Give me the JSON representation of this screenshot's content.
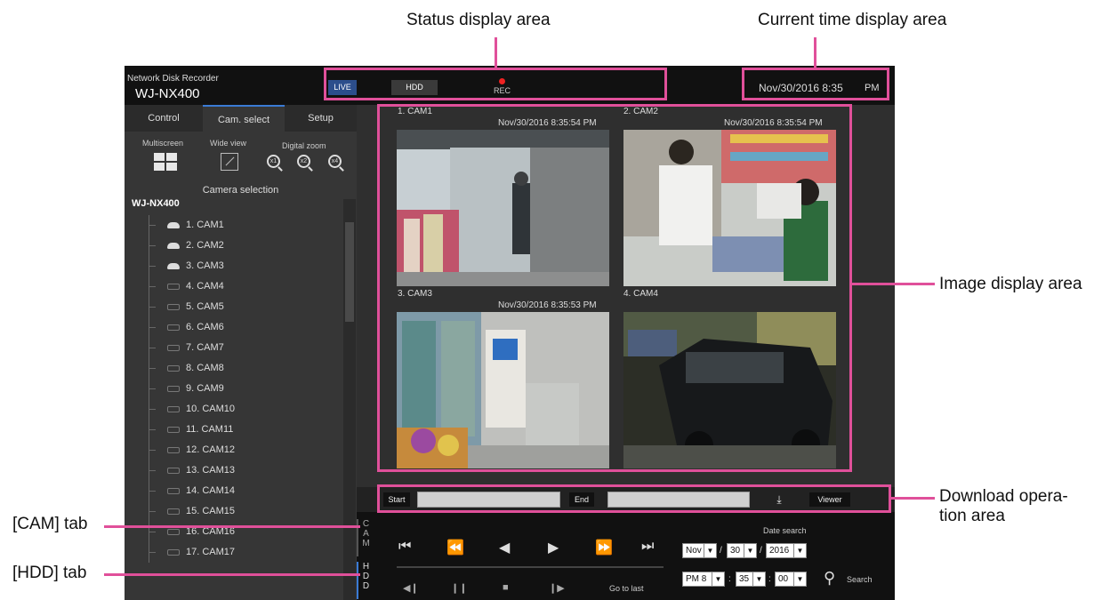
{
  "annotations": {
    "status_area": "Status display area",
    "time_area": "Current time display area",
    "image_area": "Image display area",
    "download_area_line1": "Download opera-",
    "download_area_line2": "tion area",
    "cam_tab": "[CAM] tab",
    "hdd_tab": "[HDD] tab"
  },
  "header": {
    "product": "Network Disk Recorder",
    "model": "WJ-NX400",
    "live_label": "LIVE",
    "hdd_label": "HDD",
    "rec_label": "REC",
    "date_time": "Nov/30/2016  8:35",
    "ampm": "PM"
  },
  "left_panel": {
    "tabs": [
      "Control",
      "Cam. select",
      "Setup"
    ],
    "active_tab": "Cam. select",
    "multiscreen_label": "Multiscreen",
    "wide_view_label": "Wide view",
    "digital_zoom_label": "Digital zoom",
    "zoom_levels": [
      "x1",
      "x2",
      "x4"
    ],
    "camera_selection_title": "Camera selection",
    "tree_root": "WJ-NX400",
    "cameras": [
      "1. CAM1",
      "2. CAM2",
      "3. CAM3",
      "4. CAM4",
      "5. CAM5",
      "6. CAM6",
      "7. CAM7",
      "8. CAM8",
      "9. CAM9",
      "10. CAM10",
      "11. CAM11",
      "12. CAM12",
      "13. CAM13",
      "14. CAM14",
      "15. CAM15",
      "16. CAM16",
      "17. CAM17"
    ]
  },
  "feeds": [
    {
      "name": "1. CAM1",
      "timestamp": "Nov/30/2016  8:35:54 PM"
    },
    {
      "name": "2. CAM2",
      "timestamp": "Nov/30/2016  8:35:54 PM"
    },
    {
      "name": "3. CAM3",
      "timestamp": "Nov/30/2016  8:35:53 PM"
    },
    {
      "name": "4. CAM4",
      "timestamp": ""
    }
  ],
  "download": {
    "start_label": "Start",
    "end_label": "End",
    "viewer_label": "Viewer",
    "download_icon": "download-icon"
  },
  "playback": {
    "cam_tab": "CAM",
    "hdd_tab": "HDD",
    "go_to_last": "Go to last",
    "date_search_label": "Date search",
    "month": "Nov",
    "day": "30",
    "year": "2016",
    "hour": "PM 8",
    "minute": "35",
    "second": "00",
    "search_label": "Search"
  },
  "colors": {
    "annotation": "#e0509a",
    "live_button": "#2c4e8c",
    "rec_dot": "#e22222",
    "tab_accent": "#3a7bd5"
  }
}
